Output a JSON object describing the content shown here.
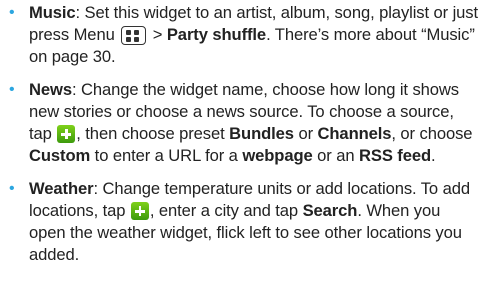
{
  "colors": {
    "bullet": "#2ca6e0",
    "text": "#222222",
    "add_icon": "#5cb515"
  },
  "icons": {
    "bullet": "blue-bullet-dot",
    "menu": "menu-key-icon",
    "add": "green-plus-icon"
  },
  "bullet_char": "•",
  "items": [
    {
      "title": "Music",
      "segments": {
        "s1": ": Set this widget to an artist, album, song, playlist or just press Menu ",
        "s2": " > ",
        "b1": "Party shuffle",
        "s3": ". There’s more about “Music” on page 30."
      }
    },
    {
      "title": "News",
      "segments": {
        "s1": ": Change the widget name, choose how long it shows new stories or choose a news source. To choose a source, tap ",
        "s2": ", then choose preset ",
        "b1": "Bundles",
        "s3": " or ",
        "b2": "Channels",
        "s4": ", or choose ",
        "b3": "Custom",
        "s5": " to enter a URL for a ",
        "b4": "webpage",
        "s6": " or an ",
        "b5": "RSS feed",
        "s7": "."
      }
    },
    {
      "title": "Weather",
      "segments": {
        "s1": ": Change temperature units or add locations. To add locations, tap ",
        "s2": ", enter a city and tap ",
        "b1": "Search",
        "s3": ". When you open the weather widget, flick left to see other locations you added."
      }
    }
  ]
}
